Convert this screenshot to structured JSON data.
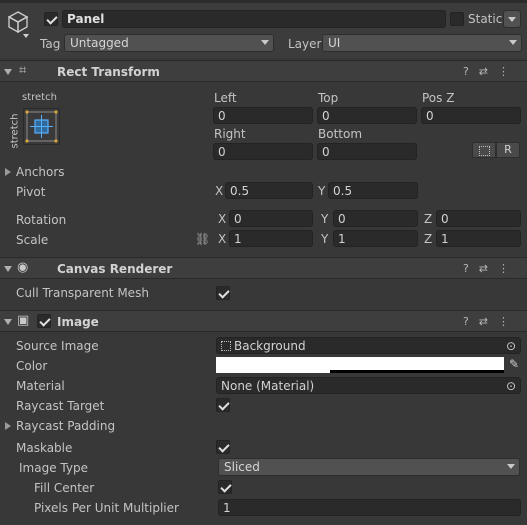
{
  "header": {
    "object_name": "Panel",
    "active": true,
    "static_label": "Static",
    "static": false,
    "tag_label": "Tag",
    "tag_value": "Untagged",
    "layer_label": "Layer",
    "layer_value": "UI"
  },
  "rect_transform": {
    "title": "Rect Transform",
    "anchor_top_label": "stretch",
    "anchor_side_label": "stretch",
    "left_label": "Left",
    "left": "0",
    "top_label": "Top",
    "top": "0",
    "posz_label": "Pos Z",
    "posz": "0",
    "right_label": "Right",
    "right": "0",
    "bottom_label": "Bottom",
    "bottom": "0",
    "raw_button": "R",
    "anchors_label": "Anchors",
    "pivot_label": "Pivot",
    "pivot_x": "0.5",
    "pivot_y": "0.5",
    "rotation_label": "Rotation",
    "rot_x": "0",
    "rot_y": "0",
    "rot_z": "0",
    "scale_label": "Scale",
    "scale_x": "1",
    "scale_y": "1",
    "scale_z": "1",
    "axis_x": "X",
    "axis_y": "Y",
    "axis_z": "Z"
  },
  "canvas_renderer": {
    "title": "Canvas Renderer",
    "cull_label": "Cull Transparent Mesh",
    "cull": true
  },
  "image": {
    "title": "Image",
    "enabled": true,
    "source_image_label": "Source Image",
    "source_image": "Background",
    "color_label": "Color",
    "color": "#ffffff",
    "material_label": "Material",
    "material": "None (Material)",
    "raycast_target_label": "Raycast Target",
    "raycast_target": true,
    "raycast_padding_label": "Raycast Padding",
    "maskable_label": "Maskable",
    "maskable": true,
    "image_type_label": "Image Type",
    "image_type": "Sliced",
    "fill_center_label": "Fill Center",
    "fill_center": true,
    "ppu_label": "Pixels Per Unit Multiplier",
    "ppu": "1"
  }
}
